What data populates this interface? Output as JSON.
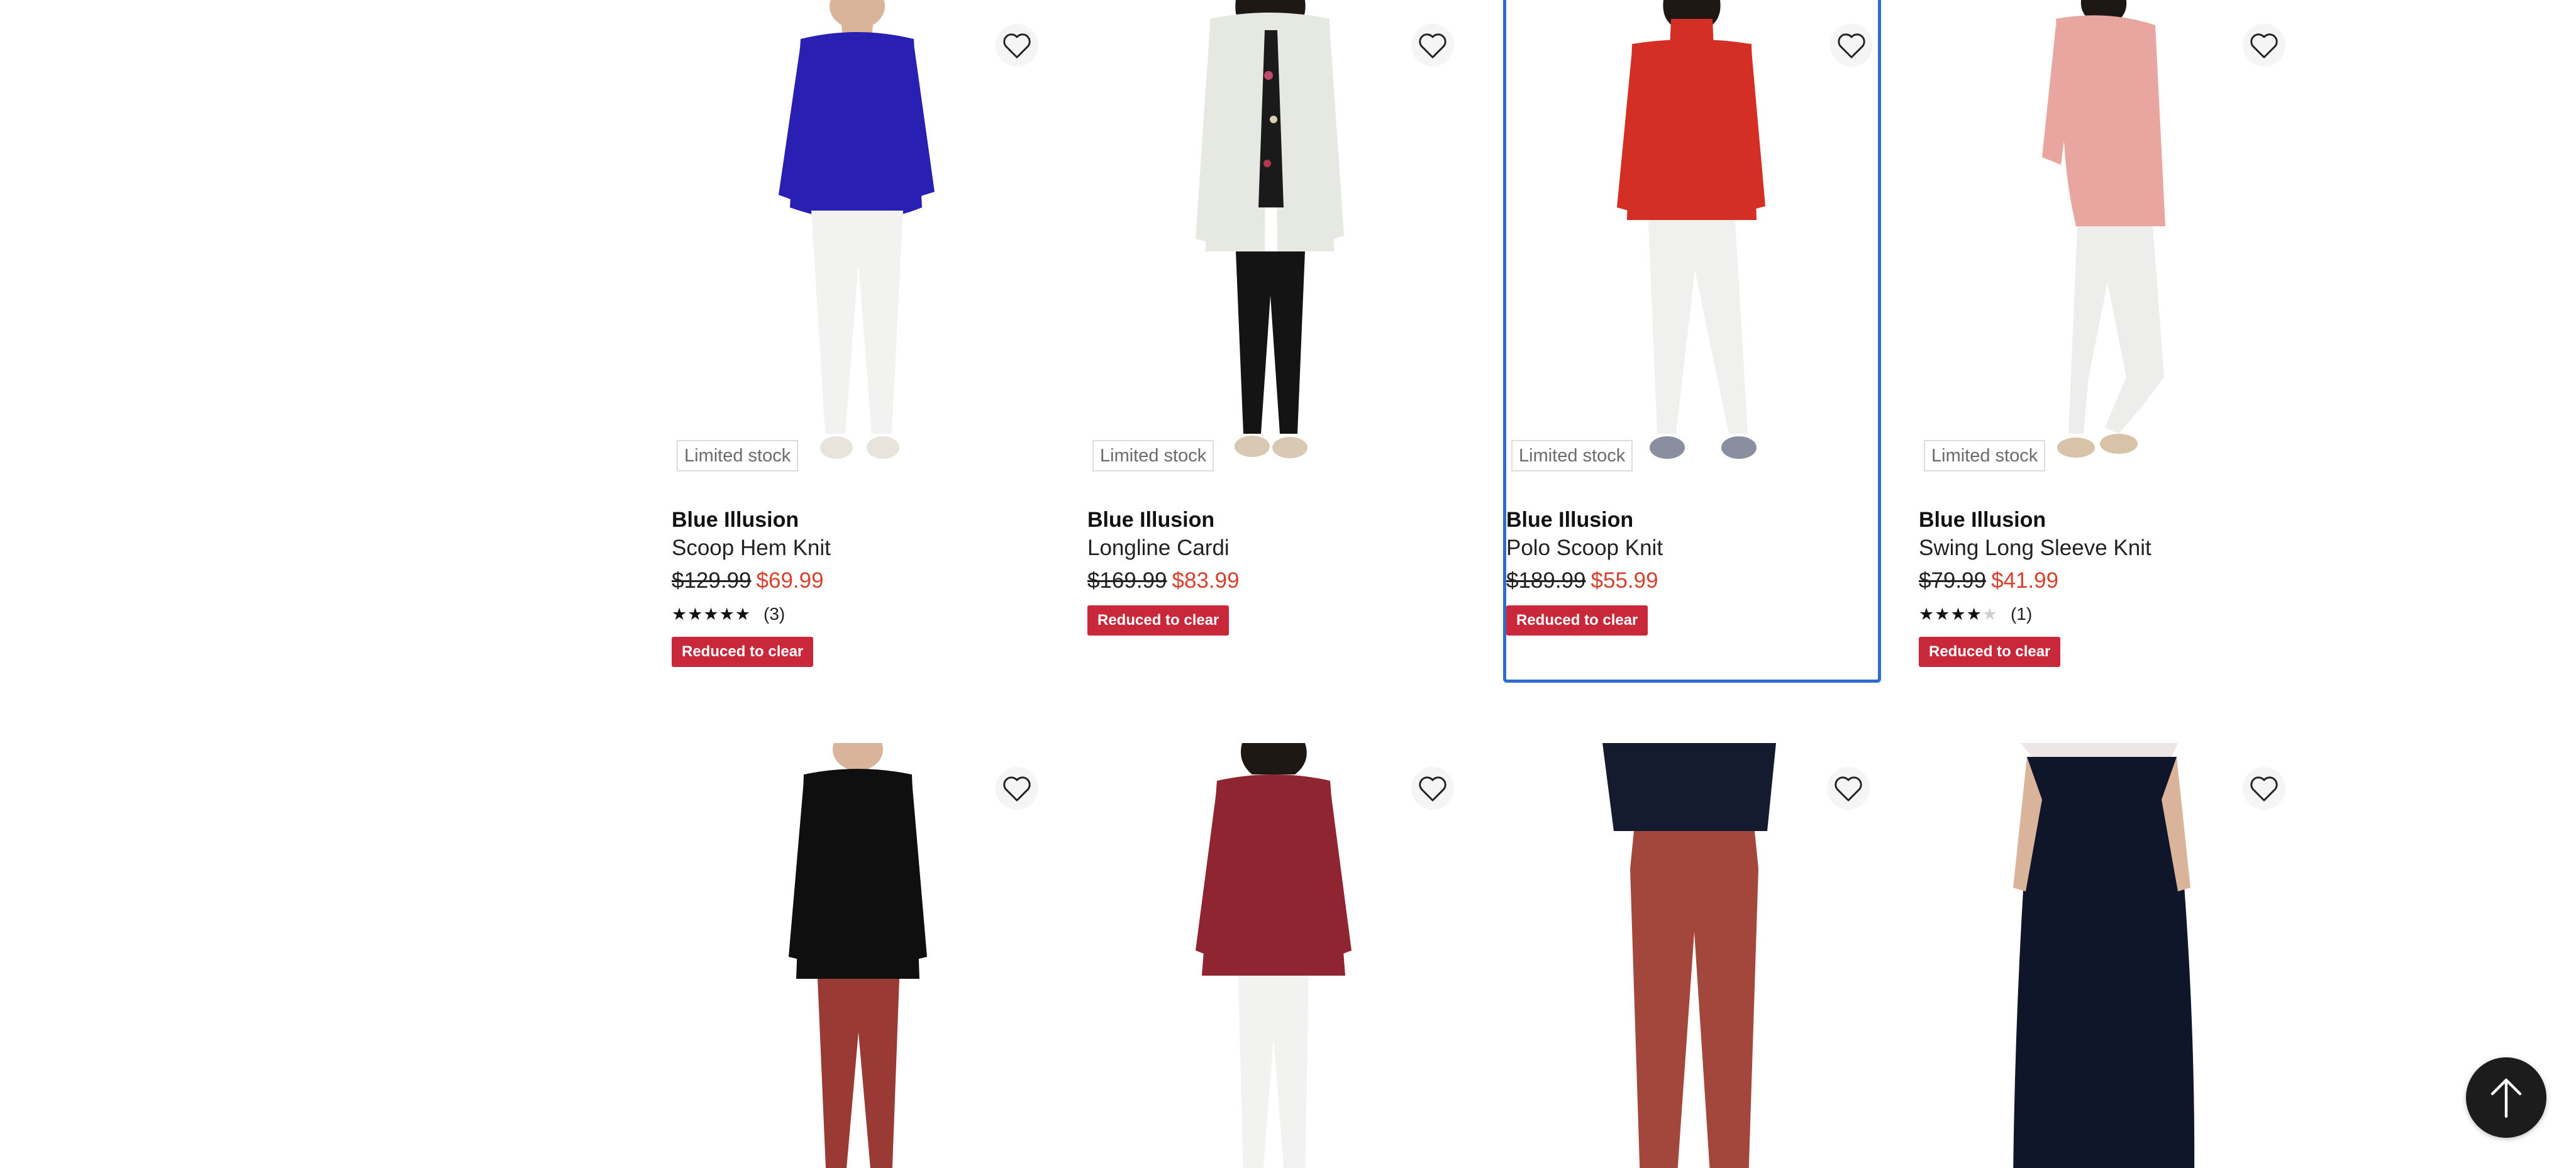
{
  "products": [
    {
      "badge": "Limited stock",
      "brand": "Blue Illusion",
      "name": "Scoop Hem Knit",
      "old_price": "$129.99",
      "new_price": "$69.99",
      "rating": {
        "stars_filled": "★★★★★",
        "stars_empty": "",
        "count": "(3)"
      },
      "tag": "Reduced to clear",
      "colors": {
        "top": "#2a1fb3",
        "bottom": "#f2f2f0",
        "shoes": "#e8e4dc"
      }
    },
    {
      "badge": "Limited stock",
      "brand": "Blue Illusion",
      "name": "Longline Cardi",
      "old_price": "$169.99",
      "new_price": "$83.99",
      "tag": "Reduced to clear",
      "colors": {
        "top": "#e6e8e2",
        "inner": "#1a1a1a",
        "bottom": "#141414",
        "shoes": "#d8c8b4"
      }
    },
    {
      "badge": "Limited stock",
      "brand": "Blue Illusion",
      "name": "Polo Scoop Knit",
      "old_price": "$189.99",
      "new_price": "$55.99",
      "tag": "Reduced to clear",
      "colors": {
        "top": "#d42f24",
        "bottom": "#f0f0ee",
        "shoes": "#8a8fa0"
      }
    },
    {
      "badge": "Limited stock",
      "brand": "Blue Illusion",
      "name": "Swing Long Sleeve Knit",
      "old_price": "$79.99",
      "new_price": "$41.99",
      "rating": {
        "stars_filled": "★★★★",
        "stars_empty": "★",
        "count": "(1)"
      },
      "tag": "Reduced to clear",
      "colors": {
        "top": "#e9a5a0",
        "bottom": "#ededeb",
        "shoes": "#d9c3a8"
      }
    },
    {
      "colors": {
        "top": "#0f0f0f",
        "bottom": "#9a3a34"
      }
    },
    {
      "colors": {
        "top": "#8e2530",
        "bottom": "#f2f2f0"
      }
    },
    {
      "colors": {
        "top": "#141b2e",
        "bottom": "#a3463c"
      }
    },
    {
      "colors": {
        "top": "#ece7e6",
        "bottom": "#101629"
      }
    }
  ]
}
